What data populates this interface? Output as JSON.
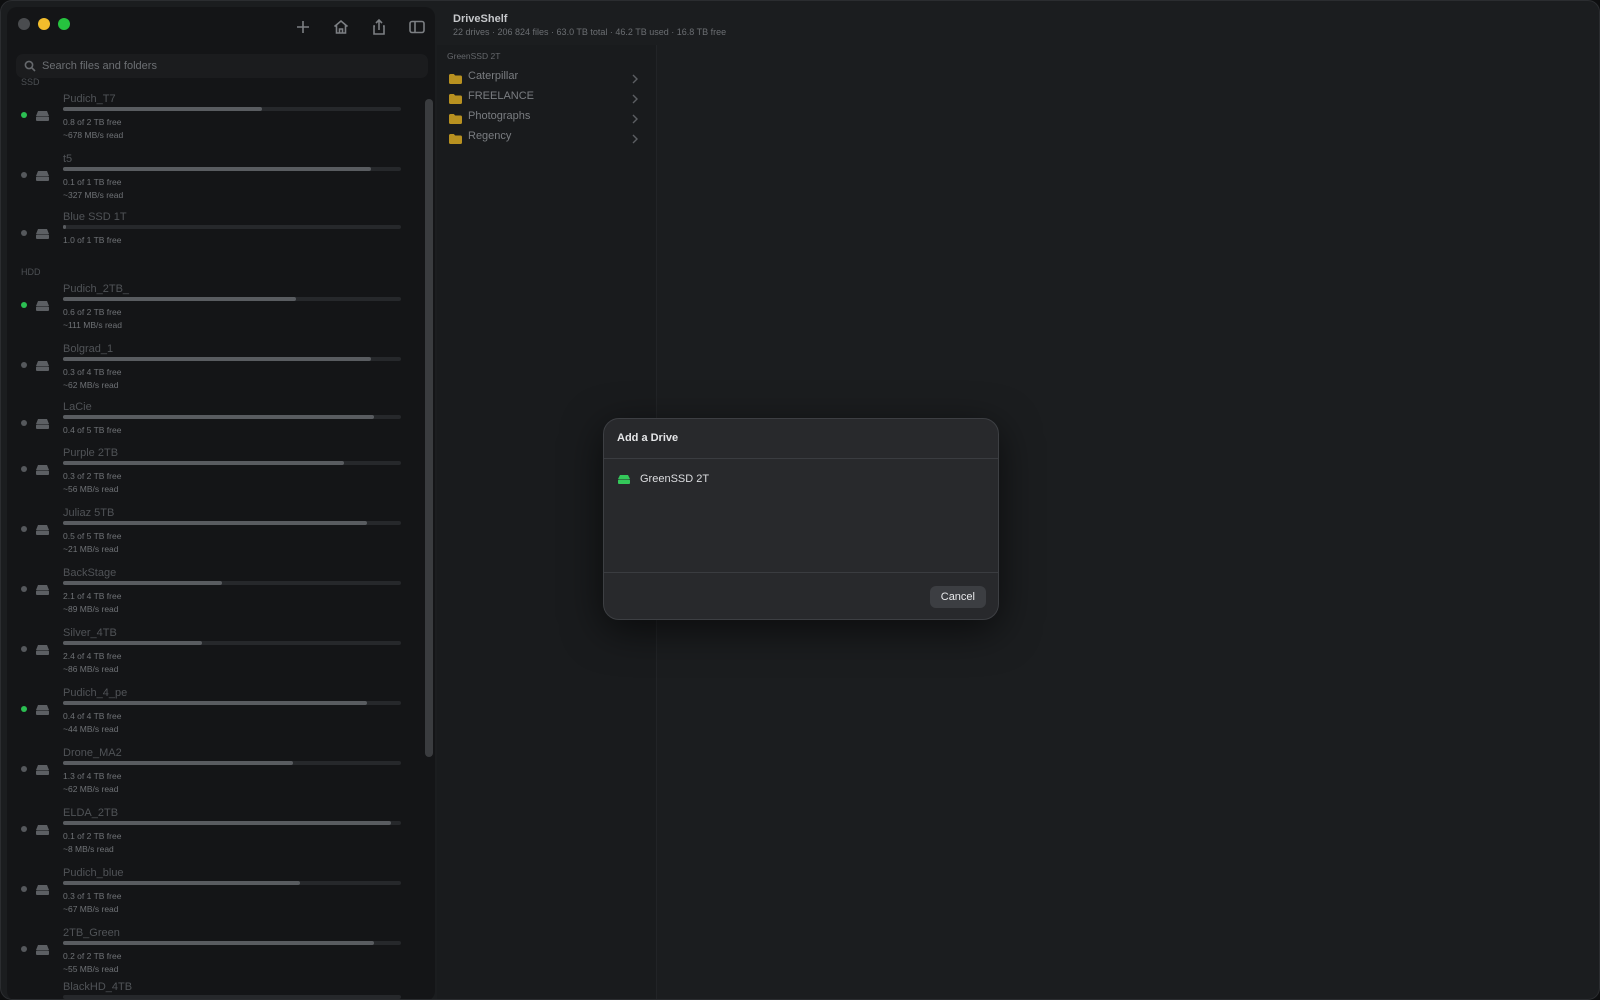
{
  "app": {
    "title": "DriveShelf",
    "subtitle": "22 drives · 206 824 files · 63.0 TB total · 46.2 TB used · 16.8 TB free"
  },
  "toolbar": {
    "icons": [
      "plus-icon",
      "home-icon",
      "share-icon",
      "sidebar-toggle-icon"
    ]
  },
  "search": {
    "placeholder": "Search files and folders"
  },
  "sections": {
    "ssd": "SSD",
    "hdd": "HDD"
  },
  "drives_ssd": [
    {
      "name": "Pudich_T7",
      "free": "0.8 of 2 TB free",
      "speed": "~678 MB/s read",
      "used_pct": 59,
      "online": true
    },
    {
      "name": "t5",
      "free": "0.1 of 1 TB free",
      "speed": "~327 MB/s read",
      "used_pct": 91,
      "online": false
    },
    {
      "name": "Blue SSD 1T",
      "free": "1.0 of 1 TB free",
      "speed": "",
      "used_pct": 1,
      "online": false
    }
  ],
  "drives_hdd": [
    {
      "name": "Pudich_2TB_",
      "free": "0.6 of 2 TB free",
      "speed": "~111 MB/s read",
      "used_pct": 69,
      "online": true
    },
    {
      "name": "Bolgrad_1",
      "free": "0.3 of 4 TB free",
      "speed": "~62 MB/s read",
      "used_pct": 91,
      "online": false
    },
    {
      "name": "LaCie",
      "free": "0.4 of 5 TB free",
      "speed": "",
      "used_pct": 92,
      "online": false
    },
    {
      "name": "Purple 2TB",
      "free": "0.3 of 2 TB free",
      "speed": "~56 MB/s read",
      "used_pct": 83,
      "online": false
    },
    {
      "name": "Juliaz 5TB",
      "free": "0.5 of 5 TB free",
      "speed": "~21 MB/s read",
      "used_pct": 90,
      "online": false
    },
    {
      "name": "BackStage",
      "free": "2.1 of 4 TB free",
      "speed": "~89 MB/s read",
      "used_pct": 47,
      "online": false
    },
    {
      "name": "Silver_4TB",
      "free": "2.4 of 4 TB free",
      "speed": "~86 MB/s read",
      "used_pct": 41,
      "online": false
    },
    {
      "name": "Pudich_4_pe",
      "free": "0.4 of 4 TB free",
      "speed": "~44 MB/s read",
      "used_pct": 90,
      "online": true
    },
    {
      "name": "Drone_MA2",
      "free": "1.3 of 4 TB free",
      "speed": "~62 MB/s read",
      "used_pct": 68,
      "online": false
    },
    {
      "name": "ELDA_2TB",
      "free": "0.1 of 2 TB free",
      "speed": "~8 MB/s read",
      "used_pct": 97,
      "online": false
    },
    {
      "name": "Pudich_blue",
      "free": "0.3 of 1 TB free",
      "speed": "~67 MB/s read",
      "used_pct": 70,
      "online": false
    },
    {
      "name": "2TB_Green",
      "free": "0.2 of 2 TB free",
      "speed": "~55 MB/s read",
      "used_pct": 92,
      "online": false
    },
    {
      "name": "BlackHD_4TB",
      "free": "",
      "speed": "",
      "used_pct": 0,
      "online": false
    }
  ],
  "browser": {
    "column_title": "GreenSSD 2T",
    "folders": [
      "Caterpillar",
      "FREELANCE",
      "Photographs",
      "Regency"
    ]
  },
  "dialog": {
    "title": "Add a Drive",
    "items": [
      {
        "label": "GreenSSD 2T",
        "icon": "green-drive-icon"
      }
    ],
    "cancel_label": "Cancel"
  },
  "colors": {
    "accent_green": "#2bbf52",
    "folder_yellow": "#b89120",
    "traffic_min": "#f2bd2c",
    "traffic_max": "#26c33f"
  }
}
